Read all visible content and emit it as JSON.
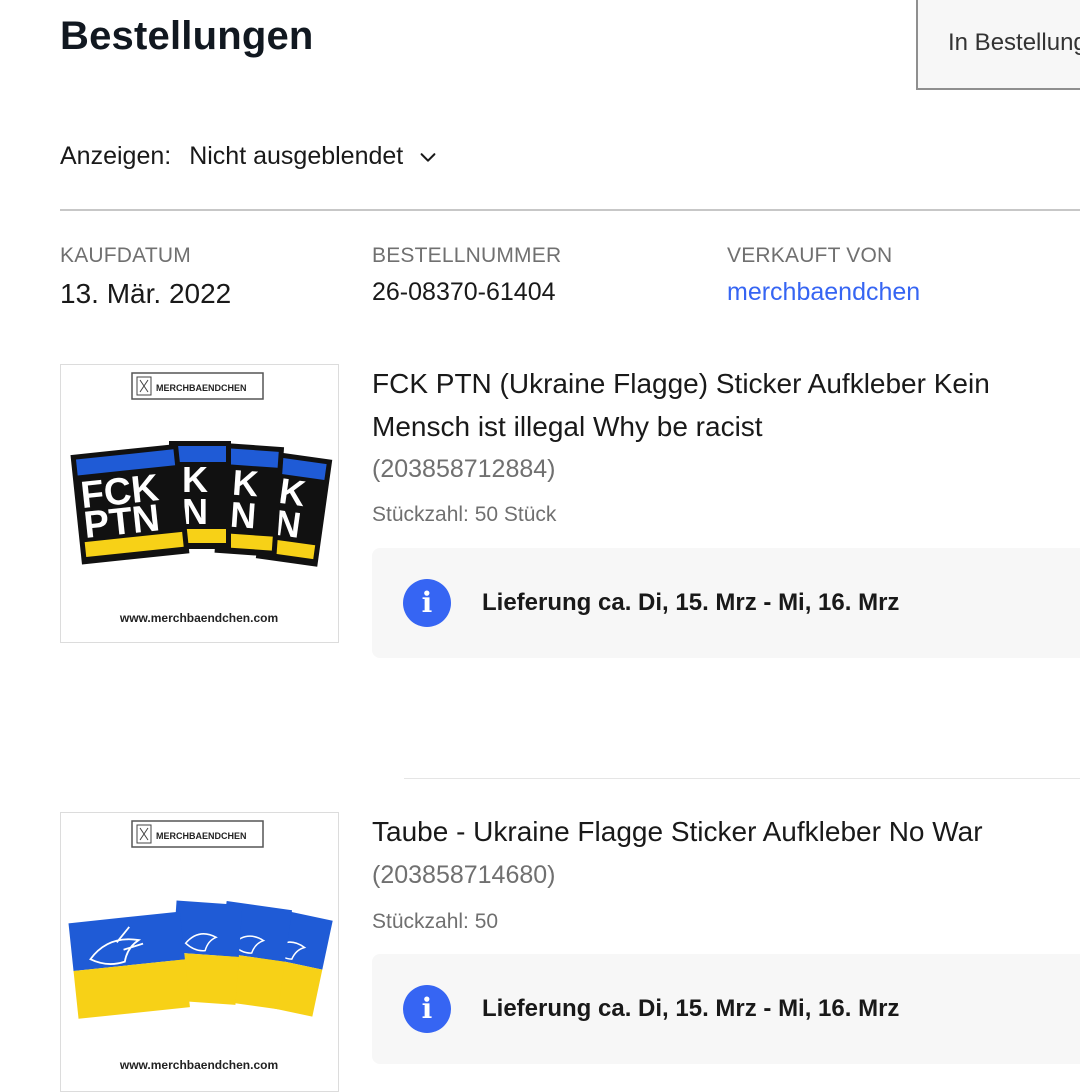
{
  "header": {
    "title": "Bestellungen",
    "search_placeholder": "In Bestellungen suchen"
  },
  "filter": {
    "label": "Anzeigen:",
    "selected": "Nicht ausgeblendet"
  },
  "order": {
    "date_label": "KAUFDATUM",
    "date_value": "13. Mär. 2022",
    "number_label": "BESTELLNUMMER",
    "number_value": "26-08370-61404",
    "seller_label": "VERKAUFT VON",
    "seller_value": "merchbaendchen"
  },
  "items": [
    {
      "title": "FCK PTN (Ukraine Flagge) Sticker Aufkleber Kein Mensch ist illegal Why be racist",
      "item_number": "(203858712884)",
      "quantity": "Stückzahl: 50 Stück",
      "delivery": "Lieferung ca. Di, 15. Mrz - Mi, 16. Mrz",
      "image": {
        "brand": "MERCHBAENDCHEN",
        "url_text": "www.merchbaendchen.com",
        "sticker_top": [
          "FCK",
          "K",
          "K",
          "K"
        ],
        "sticker_bottom": [
          "PTN",
          "N",
          "N",
          "N"
        ]
      }
    },
    {
      "title": "Taube - Ukraine Flagge Sticker Aufkleber No War",
      "item_number": "(203858714680)",
      "quantity": "Stückzahl: 50",
      "delivery": "Lieferung ca. Di, 15. Mrz - Mi, 16. Mrz",
      "image": {
        "brand": "MERCHBAENDCHEN",
        "url_text": "www.merchbaendchen.com"
      }
    }
  ],
  "colors": {
    "link": "#3665f3",
    "info_icon": "#3665f3",
    "ukraine_blue": "#1f5bd6",
    "ukraine_yellow": "#f7d117"
  },
  "icons": {
    "filter_chevron": "chevron-down-icon",
    "info": "info-icon"
  }
}
